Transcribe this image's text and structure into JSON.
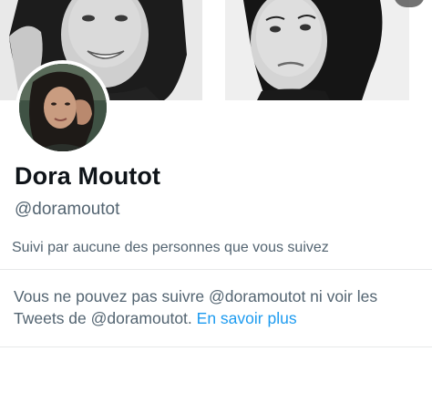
{
  "profile": {
    "display_name": "Dora Moutot",
    "handle": "@doramoutot",
    "followed_by_text": "Suivi par aucune des personnes que vous suivez"
  },
  "notice": {
    "line1": "Vous ne pouvez pas suivre @doramoutot ni voir les",
    "line2": "Tweets de @doramoutot. ",
    "link_label": "En savoir plus"
  },
  "colors": {
    "link": "#1d9bf0",
    "secondary_text": "#536471",
    "primary_text": "#0f1419",
    "divider": "#e7e9ea"
  },
  "icons": {
    "overflow": "more-icon"
  }
}
